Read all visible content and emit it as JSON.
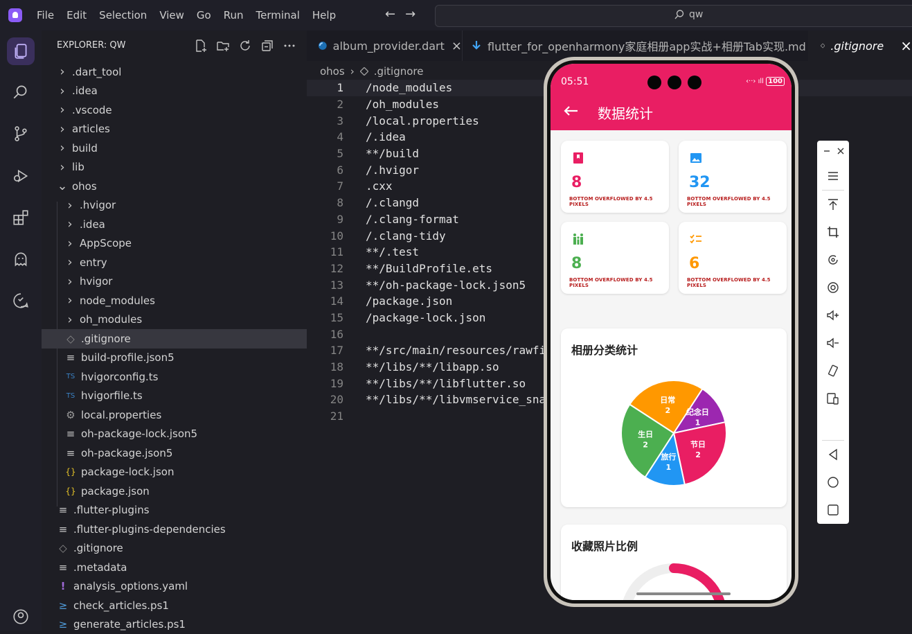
{
  "menu": [
    "File",
    "Edit",
    "Selection",
    "View",
    "Go",
    "Run",
    "Terminal",
    "Help"
  ],
  "search": {
    "query": "qw"
  },
  "sidebar": {
    "title": "EXPLORER: QW",
    "tree": [
      {
        "label": ".dart_tool",
        "type": "folder",
        "depth": 0,
        "icon": "chevron-right"
      },
      {
        "label": ".idea",
        "type": "folder",
        "depth": 0,
        "icon": "chevron-right"
      },
      {
        "label": ".vscode",
        "type": "folder",
        "depth": 0,
        "icon": "chevron-right"
      },
      {
        "label": "articles",
        "type": "folder",
        "depth": 0,
        "icon": "chevron-right"
      },
      {
        "label": "build",
        "type": "folder",
        "depth": 0,
        "icon": "chevron-right"
      },
      {
        "label": "lib",
        "type": "folder",
        "depth": 0,
        "icon": "chevron-right"
      },
      {
        "label": "ohos",
        "type": "folder",
        "depth": 0,
        "icon": "chevron-down"
      },
      {
        "label": ".hvigor",
        "type": "folder",
        "depth": 1,
        "icon": "chevron-right"
      },
      {
        "label": ".idea",
        "type": "folder",
        "depth": 1,
        "icon": "chevron-right"
      },
      {
        "label": "AppScope",
        "type": "folder",
        "depth": 1,
        "icon": "chevron-right"
      },
      {
        "label": "entry",
        "type": "folder",
        "depth": 1,
        "icon": "chevron-right"
      },
      {
        "label": "hvigor",
        "type": "folder",
        "depth": 1,
        "icon": "chevron-right"
      },
      {
        "label": "node_modules",
        "type": "folder",
        "depth": 1,
        "icon": "chevron-right"
      },
      {
        "label": "oh_modules",
        "type": "folder",
        "depth": 1,
        "icon": "chevron-right"
      },
      {
        "label": ".gitignore",
        "type": "file",
        "depth": 1,
        "icon": "git-diamond",
        "selected": true
      },
      {
        "label": "build-profile.json5",
        "type": "file",
        "depth": 1,
        "icon": "lines"
      },
      {
        "label": "hvigorconfig.ts",
        "type": "file",
        "depth": 1,
        "icon": "ts"
      },
      {
        "label": "hvigorfile.ts",
        "type": "file",
        "depth": 1,
        "icon": "ts"
      },
      {
        "label": "local.properties",
        "type": "file",
        "depth": 1,
        "icon": "gear"
      },
      {
        "label": "oh-package-lock.json5",
        "type": "file",
        "depth": 1,
        "icon": "lines"
      },
      {
        "label": "oh-package.json5",
        "type": "file",
        "depth": 1,
        "icon": "lines"
      },
      {
        "label": "package-lock.json",
        "type": "file",
        "depth": 1,
        "icon": "braces"
      },
      {
        "label": "package.json",
        "type": "file",
        "depth": 1,
        "icon": "braces"
      },
      {
        "label": ".flutter-plugins",
        "type": "file",
        "depth": 0,
        "icon": "lines"
      },
      {
        "label": ".flutter-plugins-dependencies",
        "type": "file",
        "depth": 0,
        "icon": "lines"
      },
      {
        "label": ".gitignore",
        "type": "file",
        "depth": 0,
        "icon": "git-diamond"
      },
      {
        "label": ".metadata",
        "type": "file",
        "depth": 0,
        "icon": "lines"
      },
      {
        "label": "analysis_options.yaml",
        "type": "file",
        "depth": 0,
        "icon": "exclaim"
      },
      {
        "label": "check_articles.ps1",
        "type": "file",
        "depth": 0,
        "icon": "powershell"
      },
      {
        "label": "generate_articles.ps1",
        "type": "file",
        "depth": 0,
        "icon": "powershell"
      }
    ]
  },
  "tabs": [
    {
      "label": "album_provider.dart",
      "icon": "dart-icon",
      "close": "×"
    },
    {
      "label": "flutter_for_openharmony家庭相册app实战+相册Tab实现.md",
      "icon": "markdown-icon",
      "close": ""
    },
    {
      "label": ".gitignore",
      "icon": "git-diamond",
      "close": "×",
      "active": true
    }
  ],
  "breadcrumb": [
    "ohos",
    ".gitignore"
  ],
  "code_lines": [
    "/node_modules",
    "/oh_modules",
    "/local.properties",
    "/.idea",
    "**/build",
    "/.hvigor",
    ".cxx",
    "/.clangd",
    "/.clang-format",
    "/.clang-tidy",
    "**/.test",
    "**/BuildProfile.ets",
    "**/oh-package-lock.json5",
    "/package.json",
    "/package-lock.json",
    "",
    "**/src/main/resources/rawfi",
    "**/libs/**/libapp.so",
    "**/libs/**/libflutter.so",
    "**/libs/**/libvmservice_sna",
    ""
  ],
  "phone": {
    "time": "05:51",
    "battery": "100",
    "title": "数据统计",
    "overflow_text": "BOTTOM OVERFLOWED BY 4.5 PIXELS",
    "stats": [
      {
        "value": "8",
        "icon": "album-icon",
        "color": "#e91e63"
      },
      {
        "value": "32",
        "icon": "photo-icon",
        "color": "#2196f3"
      },
      {
        "value": "8",
        "icon": "family-icon",
        "color": "#4caf50"
      },
      {
        "value": "6",
        "icon": "checklist-icon",
        "color": "#ff9800"
      }
    ],
    "category_title": "相册分类统计",
    "favorite_title": "收藏照片比例",
    "favorite_ratio": 0.25
  },
  "chart_data": {
    "type": "pie",
    "title": "相册分类统计",
    "slices": [
      {
        "label": "日常",
        "value": 2,
        "color": "#ff9800"
      },
      {
        "label": "纪念日",
        "value": 1,
        "color": "#9c27b0"
      },
      {
        "label": "节日",
        "value": 2,
        "color": "#e91e63"
      },
      {
        "label": "旅行",
        "value": 1,
        "color": "#2196f3"
      },
      {
        "label": "生日",
        "value": 2,
        "color": "#4caf50"
      }
    ]
  }
}
